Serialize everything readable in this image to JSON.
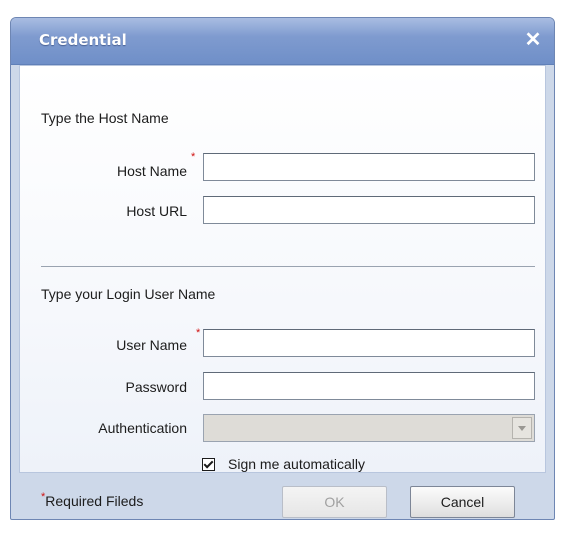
{
  "window": {
    "title": "Credential",
    "close_glyph": "✕"
  },
  "host_section": {
    "title": "Type the Host Name",
    "host_name": {
      "label": "Host Name",
      "required": true,
      "value": "",
      "placeholder": ""
    },
    "host_url": {
      "label": "Host URL",
      "required": false,
      "value": "",
      "placeholder": ""
    }
  },
  "login_section": {
    "title": "Type your Login User Name",
    "user_name": {
      "label": "User Name",
      "required": true,
      "value": "",
      "placeholder": ""
    },
    "password": {
      "label": "Password",
      "required": false,
      "value": ""
    },
    "authentication": {
      "label": "Authentication",
      "value": "",
      "disabled": true
    },
    "sign_automatically": {
      "label": "Sign me automatically",
      "checked": true
    }
  },
  "footer": {
    "required_star": "*",
    "required_note": "Required Fileds",
    "ok_label": "OK",
    "ok_disabled": true,
    "cancel_label": "Cancel"
  },
  "colors": {
    "titlebar": "#7f9bcf",
    "dialog_bg": "#cdd8e9",
    "required_star": "#d01010"
  },
  "icons": {
    "close": "close-icon",
    "dropdown": "chevron-down-icon",
    "check": "checkmark-icon"
  }
}
